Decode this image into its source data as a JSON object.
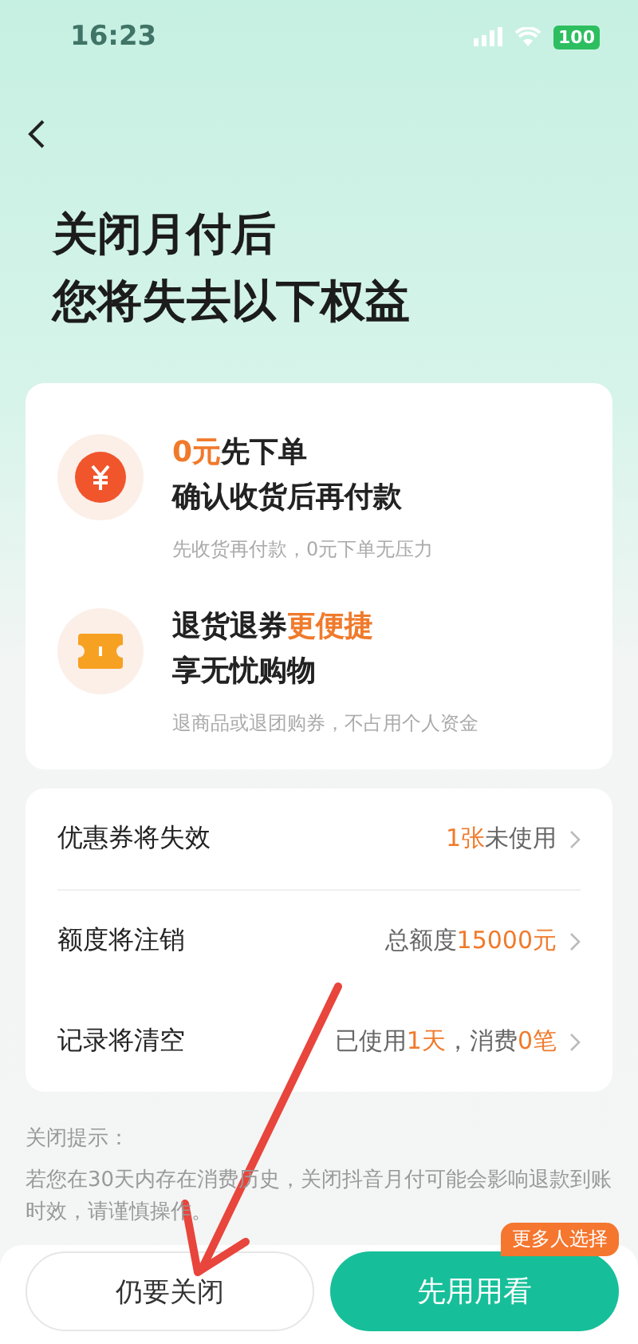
{
  "status_bar": {
    "time": "16:23",
    "battery": "100"
  },
  "title_lines": [
    "关闭月付后",
    "您将失去以下权益"
  ],
  "benefits": [
    {
      "kind": "yuan",
      "headline": [
        {
          "text": "0元",
          "accent": true
        },
        {
          "text": "先下单",
          "accent": false
        }
      ],
      "subline": "确认收货后再付款",
      "note": "先收货再付款，0元下单无压力"
    },
    {
      "kind": "ticket",
      "headline": [
        {
          "text": "退货退券",
          "accent": false
        },
        {
          "text": "更便捷",
          "accent": true
        }
      ],
      "subline": "享无忧购物",
      "note": "退商品或退团购券，不占用个人资金"
    }
  ],
  "rows": [
    {
      "label": "优惠券将失效",
      "value": [
        {
          "text": "1张",
          "accent": true
        },
        {
          "text": "未使用",
          "accent": false
        }
      ]
    },
    {
      "label": "额度将注销",
      "value": [
        {
          "text": "总额度",
          "accent": false
        },
        {
          "text": "15000元",
          "accent": true
        }
      ]
    },
    {
      "label": "记录将清空",
      "value": [
        {
          "text": "已使用",
          "accent": false
        },
        {
          "text": "1天",
          "accent": true
        },
        {
          "text": "，消费",
          "accent": false
        },
        {
          "text": "0笔",
          "accent": true
        }
      ]
    }
  ],
  "notice": {
    "heading": "关闭提示：",
    "paragraphs": [
      "若您在30天内存在消费历史，关闭抖音月付可能会影响退款到账时效，请谨慎操作。"
    ]
  },
  "buttons": {
    "close": "仍要关闭",
    "keep": "先用用看",
    "badge": "更多人选择"
  }
}
